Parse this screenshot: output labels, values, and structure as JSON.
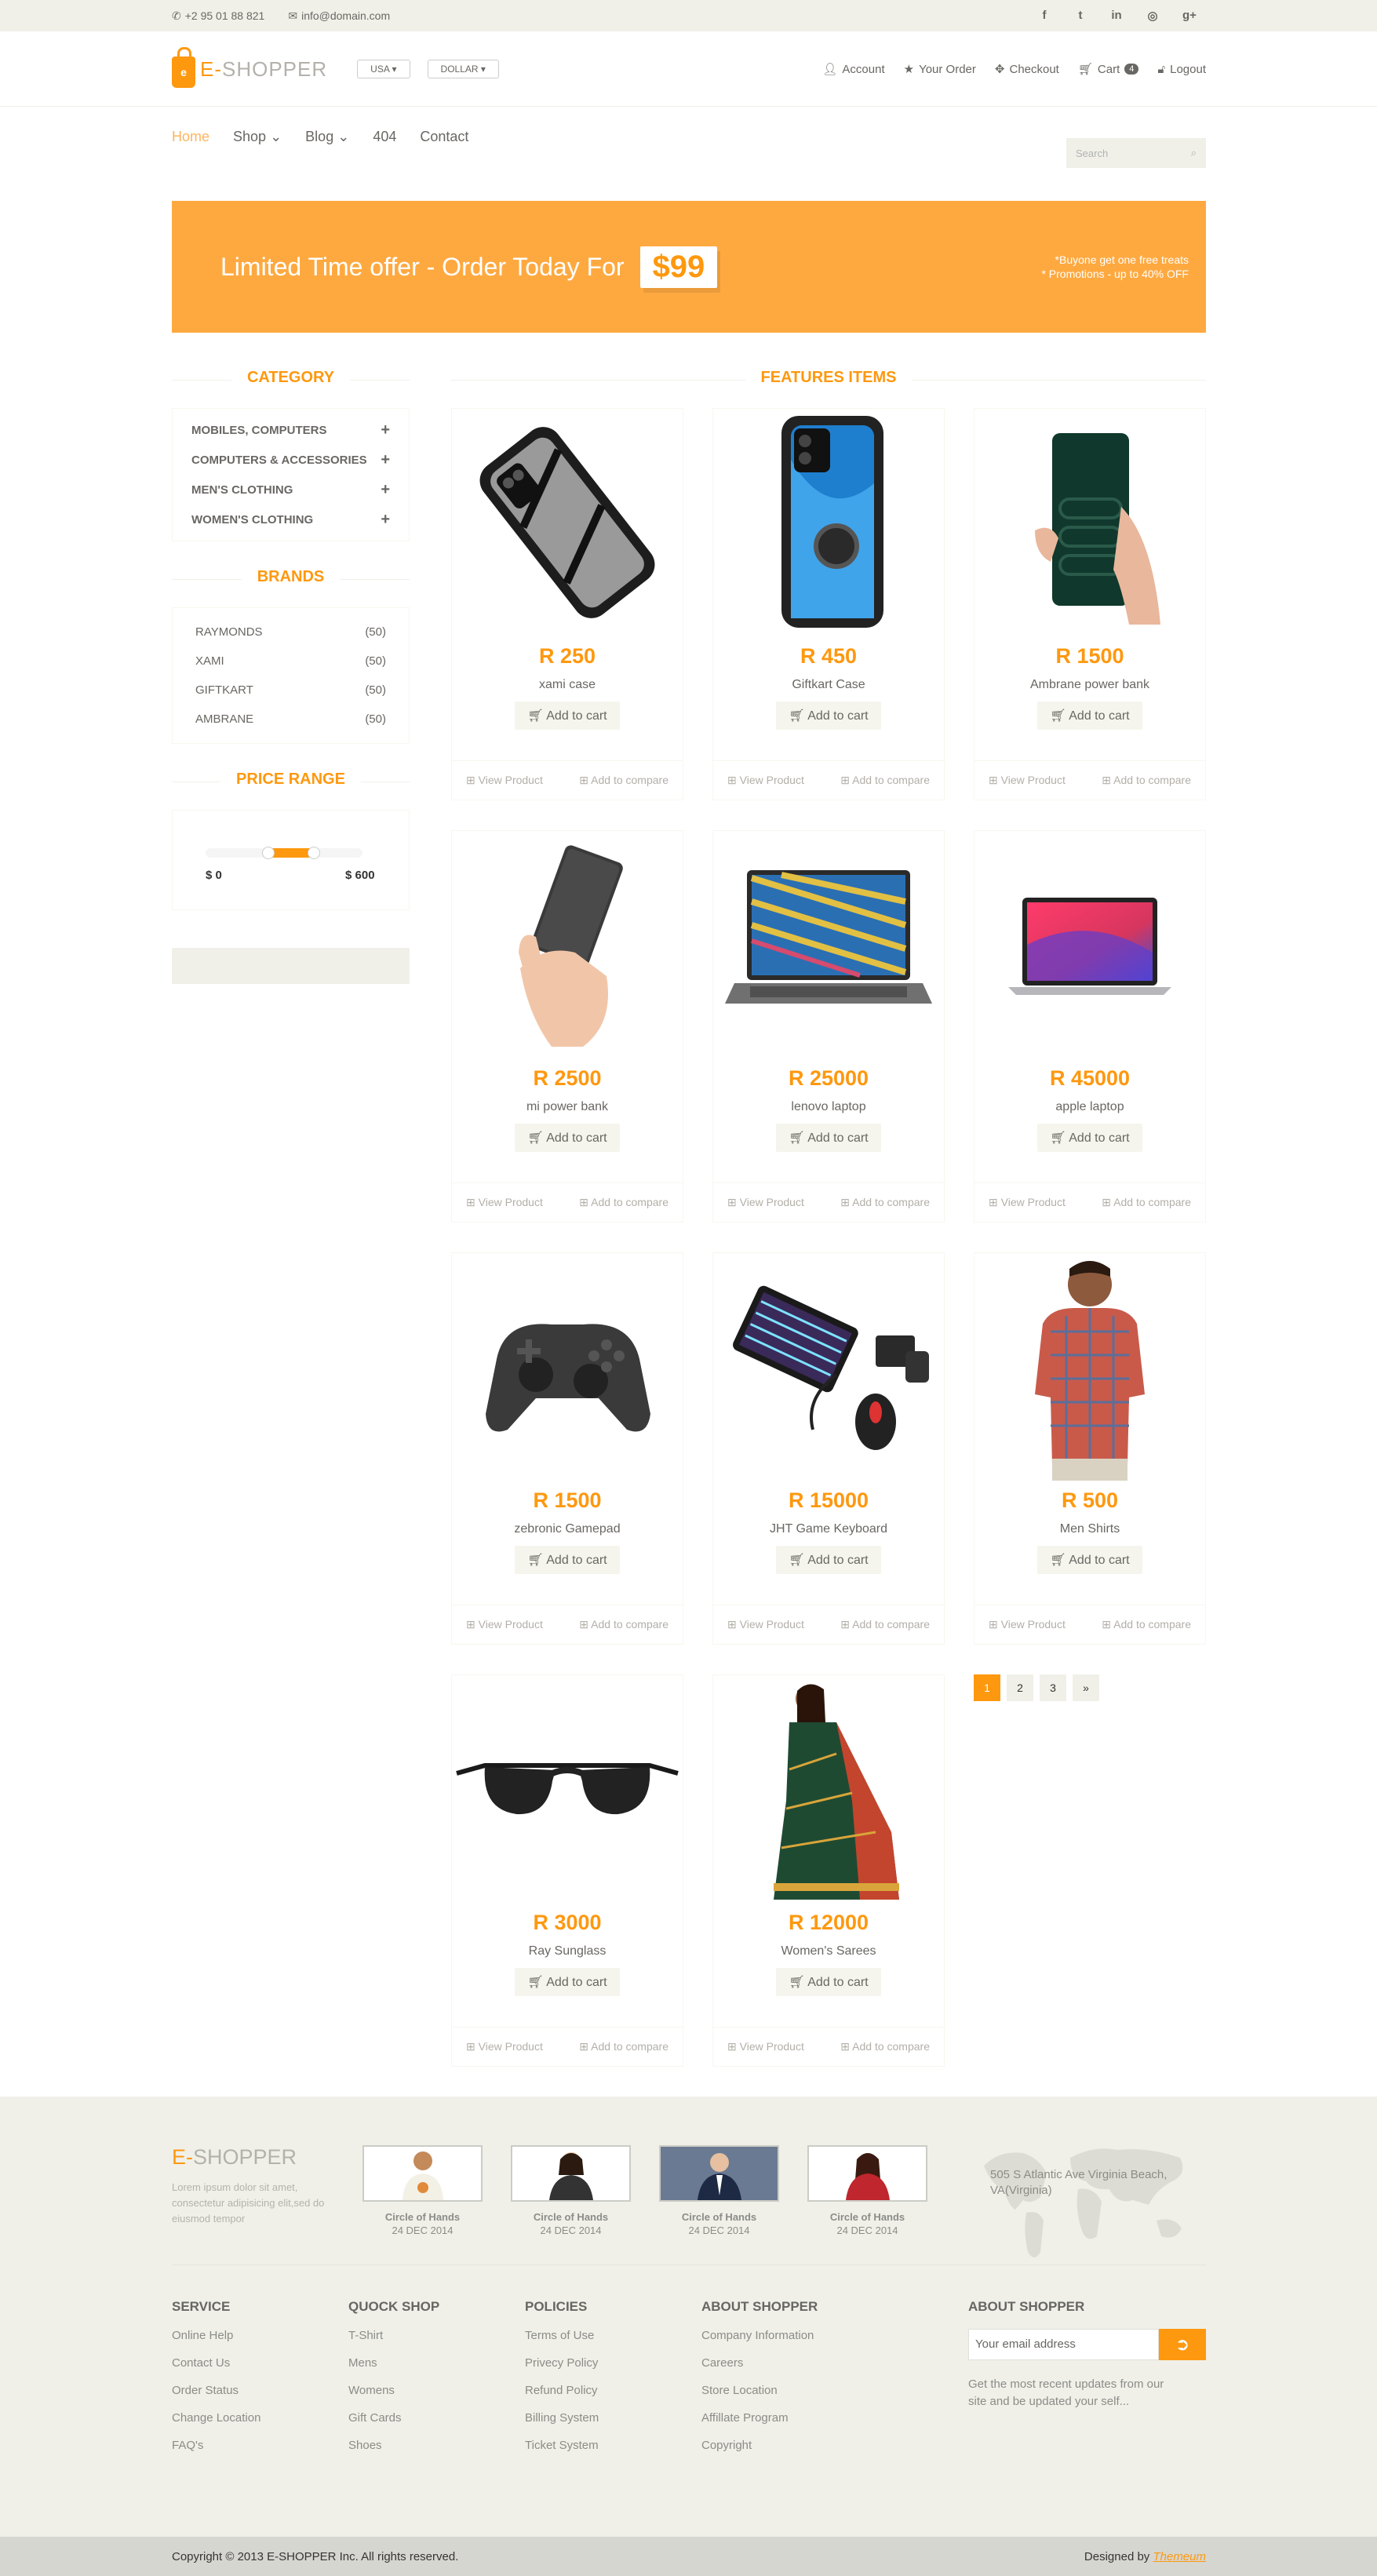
{
  "topbar": {
    "phone": "+2 95 01 88 821",
    "email": "info@domain.com",
    "social_icons": [
      "facebook-icon",
      "twitter-icon",
      "linkedin-icon",
      "dribbble-icon",
      "google-plus-icon"
    ]
  },
  "header": {
    "brand_first": "E-",
    "brand_rest": "SHOPPER",
    "country": "USA",
    "currency": "DOLLAR",
    "menu": {
      "account": "Account",
      "order": "Your Order",
      "checkout": "Checkout",
      "cart": "Cart",
      "cart_count": "4",
      "logout": "Logout"
    }
  },
  "nav": {
    "items": [
      "Home",
      "Shop",
      "Blog",
      "404",
      "Contact"
    ],
    "search_placeholder": "Search"
  },
  "banner": {
    "text": "Limited Time offer - Order Today For",
    "price": "$99",
    "promo1": "*Buyone get one free treats",
    "promo2": "* Promotions - up to 40% OFF"
  },
  "sidebar": {
    "category_title": "CATEGORY",
    "categories": [
      "MOBILES, COMPUTERS",
      "COMPUTERS & ACCESSORIES",
      "MEN'S CLOTHING",
      "WOMEN'S CLOTHING"
    ],
    "brands_title": "BRANDS",
    "brands": [
      {
        "name": "RAYMONDS",
        "count": "(50)"
      },
      {
        "name": "XAMI",
        "count": "(50)"
      },
      {
        "name": "GIFTKART",
        "count": "(50)"
      },
      {
        "name": "AMBRANE",
        "count": "(50)"
      }
    ],
    "price_title": "PRICE RANGE",
    "price_low": "$ 0",
    "price_high": "$ 600"
  },
  "main": {
    "title": "FEATURES ITEMS",
    "add_to_cart": "Add to cart",
    "view_product": "View Product",
    "add_compare": "Add to compare",
    "products": [
      {
        "price": "R 250",
        "name": "xami case"
      },
      {
        "price": "R 450",
        "name": "Giftkart Case"
      },
      {
        "price": "R 1500",
        "name": "Ambrane power bank"
      },
      {
        "price": "R 2500",
        "name": "mi power bank"
      },
      {
        "price": "R 25000",
        "name": "lenovo laptop"
      },
      {
        "price": "R 45000",
        "name": "apple laptop"
      },
      {
        "price": "R 1500",
        "name": "zebronic Gamepad"
      },
      {
        "price": "R 15000",
        "name": "JHT Game Keyboard"
      },
      {
        "price": "R 500",
        "name": "Men Shirts"
      },
      {
        "price": "R 3000",
        "name": "Ray Sunglass"
      },
      {
        "price": "R 12000",
        "name": "Women's Sarees"
      }
    ],
    "pages": [
      "1",
      "2",
      "3",
      "»"
    ]
  },
  "footer": {
    "brand_first": "E-",
    "brand_rest": "SHOPPER",
    "lorem": "Lorem ipsum dolor sit amet, consectetur adipisicing elit,sed do eiusmod tempor",
    "videos": [
      {
        "title": "Circle of Hands",
        "date": "24 DEC 2014"
      },
      {
        "title": "Circle of Hands",
        "date": "24 DEC 2014"
      },
      {
        "title": "Circle of Hands",
        "date": "24 DEC 2014"
      },
      {
        "title": "Circle of Hands",
        "date": "24 DEC 2014"
      }
    ],
    "address": "505 S Atlantic Ave Virginia Beach, VA(Virginia)",
    "columns": [
      {
        "title": "SERVICE",
        "links": [
          "Online Help",
          "Contact Us",
          "Order Status",
          "Change Location",
          "FAQ's"
        ]
      },
      {
        "title": "QUOCK SHOP",
        "links": [
          "T-Shirt",
          "Mens",
          "Womens",
          "Gift Cards",
          "Shoes"
        ]
      },
      {
        "title": "POLICIES",
        "links": [
          "Terms of Use",
          "Privecy Policy",
          "Refund Policy",
          "Billing System",
          "Ticket System"
        ]
      },
      {
        "title": "ABOUT SHOPPER",
        "links": [
          "Company Information",
          "Careers",
          "Store Location",
          "Affillate Program",
          "Copyright"
        ]
      }
    ],
    "subscribe_title": "ABOUT SHOPPER",
    "subscribe_placeholder": "Your email address",
    "subscribe_text": "Get the most recent updates from our site and be updated your self...",
    "copyright": "Copyright © 2013 E-SHOPPER Inc. All rights reserved.",
    "designed_by": "Designed by",
    "designer": "Themeum"
  }
}
